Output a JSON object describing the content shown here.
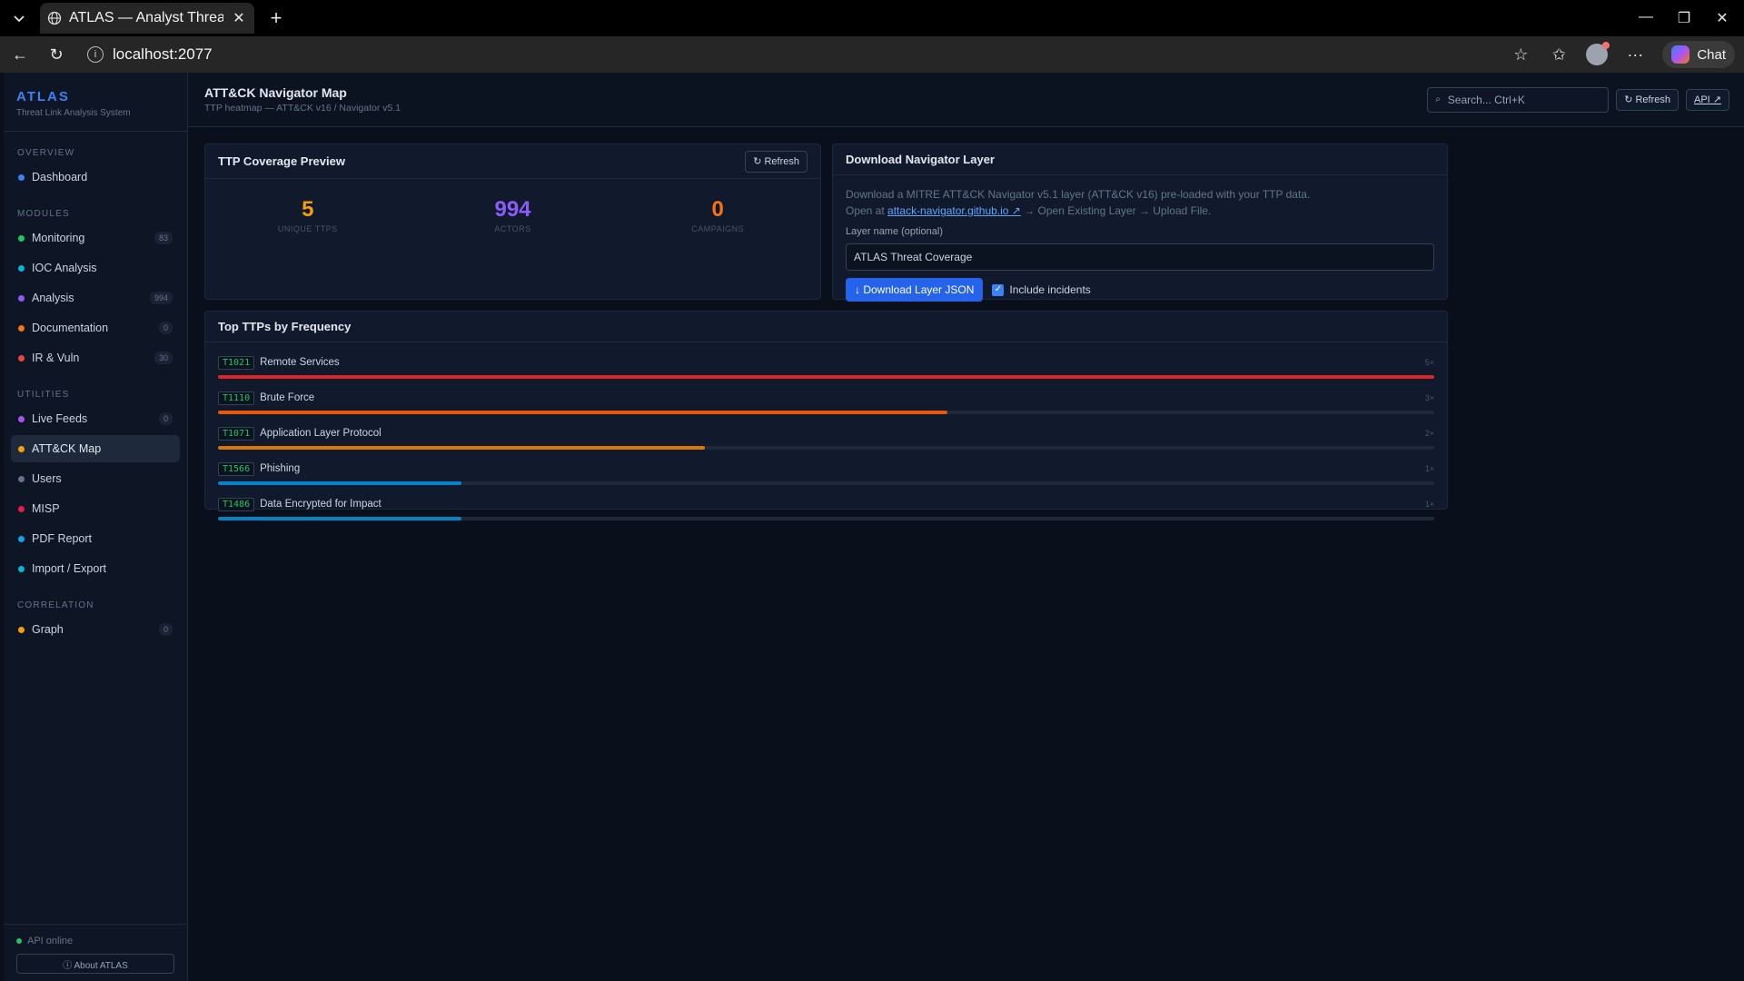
{
  "browser": {
    "tab_title": "ATLAS — Analyst Threat & I",
    "url": "localhost:2077",
    "chat_label": "Chat"
  },
  "sidebar": {
    "brand": "ATLAS",
    "subtitle": "Threat Link Analysis System",
    "sections": {
      "overview": "OVERVIEW",
      "modules": "MODULES",
      "utilities": "UTILITIES",
      "correlation": "CORRELATION"
    },
    "items": [
      {
        "label": "Dashboard",
        "badge": "",
        "color": "#3b82f6"
      },
      {
        "label": "Monitoring",
        "badge": "83",
        "color": "#22c55e"
      },
      {
        "label": "IOC Analysis",
        "badge": "",
        "color": "#06b6d4"
      },
      {
        "label": "Analysis",
        "badge": "994",
        "color": "#8b5cf6"
      },
      {
        "label": "Documentation",
        "badge": "0",
        "color": "#f97316"
      },
      {
        "label": "IR & Vuln",
        "badge": "30",
        "color": "#ef4444"
      },
      {
        "label": "Live Feeds",
        "badge": "0",
        "color": "#a855f7"
      },
      {
        "label": "ATT&CK Map",
        "badge": "",
        "color": "#f59e0b"
      },
      {
        "label": "Users",
        "badge": "",
        "color": "#64748b"
      },
      {
        "label": "MISP",
        "badge": "",
        "color": "#e11d48"
      },
      {
        "label": "PDF Report",
        "badge": "",
        "color": "#0ea5e9"
      },
      {
        "label": "Import / Export",
        "badge": "",
        "color": "#06b6d4"
      },
      {
        "label": "Graph",
        "badge": "0",
        "color": "#f59e0b"
      }
    ],
    "api_status": "API online",
    "about": "ⓘ About ATLAS"
  },
  "header": {
    "title": "ATT&CK Navigator Map",
    "subtitle": "TTP heatmap — ATT&CK v16 / Navigator v5.1",
    "search_placeholder": "Search...  Ctrl+K",
    "refresh": "↻ Refresh",
    "api": "API ↗"
  },
  "coverage": {
    "title": "TTP Coverage Preview",
    "refresh": "↻ Refresh",
    "stats": [
      {
        "value": "5",
        "label": "UNIQUE TTPS",
        "color": "#f59e0b"
      },
      {
        "value": "994",
        "label": "ACTORS",
        "color": "#8b5cf6"
      },
      {
        "value": "0",
        "label": "CAMPAIGNS",
        "color": "#f97316"
      }
    ]
  },
  "download": {
    "title": "Download Navigator Layer",
    "desc1": "Download a MITRE ATT&CK Navigator v5.1 layer (ATT&CK v16) pre-loaded with your TTP data.",
    "desc2_prefix": "Open at",
    "link": "attack-navigator.github.io ↗",
    "desc2_suffix": "→ Open Existing Layer → Upload File.",
    "field_label": "Layer name (optional)",
    "field_value": "ATLAS Threat Coverage",
    "button": "↓ Download Layer JSON",
    "checkbox_label": "Include incidents",
    "checkbox_checked": true
  },
  "top_ttps": {
    "title": "Top TTPs by Frequency",
    "rows": [
      {
        "id": "T1021",
        "name": "Remote Services",
        "count": "5×",
        "fraction": 1.0,
        "color": "#dc2626"
      },
      {
        "id": "T1110",
        "name": "Brute Force",
        "count": "3×",
        "fraction": 0.6,
        "color": "#ea580c"
      },
      {
        "id": "T1071",
        "name": "Application Layer Protocol",
        "count": "2×",
        "fraction": 0.4,
        "color": "#d97706"
      },
      {
        "id": "T1566",
        "name": "Phishing",
        "count": "1×",
        "fraction": 0.2,
        "color": "#0284c7"
      },
      {
        "id": "T1486",
        "name": "Data Encrypted for Impact",
        "count": "1×",
        "fraction": 0.2,
        "color": "#0284c7"
      }
    ]
  }
}
